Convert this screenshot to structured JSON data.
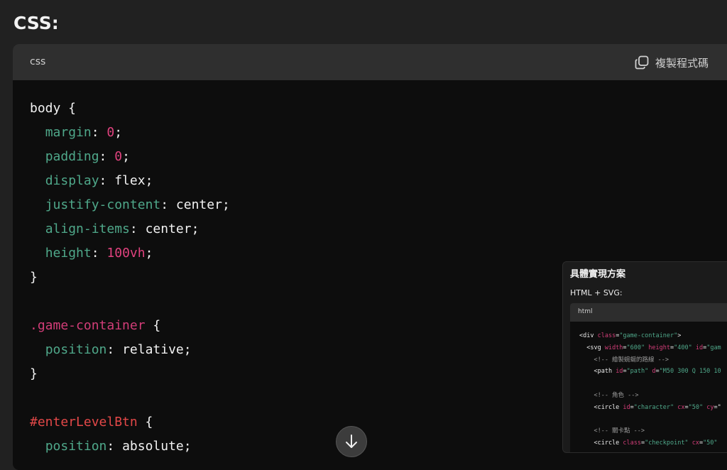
{
  "heading": "CSS:",
  "code_block": {
    "language": "css",
    "copy_label": "複製程式碼",
    "lines": [
      [
        {
          "t": "plain",
          "v": "body {"
        }
      ],
      [
        {
          "t": "plain",
          "v": "  "
        },
        {
          "t": "prop",
          "v": "margin"
        },
        {
          "t": "plain",
          "v": ": "
        },
        {
          "t": "num",
          "v": "0"
        },
        {
          "t": "plain",
          "v": ";"
        }
      ],
      [
        {
          "t": "plain",
          "v": "  "
        },
        {
          "t": "prop",
          "v": "padding"
        },
        {
          "t": "plain",
          "v": ": "
        },
        {
          "t": "num",
          "v": "0"
        },
        {
          "t": "plain",
          "v": ";"
        }
      ],
      [
        {
          "t": "plain",
          "v": "  "
        },
        {
          "t": "prop",
          "v": "display"
        },
        {
          "t": "plain",
          "v": ": flex;"
        }
      ],
      [
        {
          "t": "plain",
          "v": "  "
        },
        {
          "t": "prop",
          "v": "justify-content"
        },
        {
          "t": "plain",
          "v": ": center;"
        }
      ],
      [
        {
          "t": "plain",
          "v": "  "
        },
        {
          "t": "prop",
          "v": "align-items"
        },
        {
          "t": "plain",
          "v": ": center;"
        }
      ],
      [
        {
          "t": "plain",
          "v": "  "
        },
        {
          "t": "prop",
          "v": "height"
        },
        {
          "t": "plain",
          "v": ": "
        },
        {
          "t": "num",
          "v": "100vh"
        },
        {
          "t": "plain",
          "v": ";"
        }
      ],
      [
        {
          "t": "plain",
          "v": "}"
        }
      ],
      [
        {
          "t": "plain",
          "v": ""
        }
      ],
      [
        {
          "t": "cls",
          "v": ".game-container"
        },
        {
          "t": "plain",
          "v": " {"
        }
      ],
      [
        {
          "t": "plain",
          "v": "  "
        },
        {
          "t": "prop",
          "v": "position"
        },
        {
          "t": "plain",
          "v": ": relative;"
        }
      ],
      [
        {
          "t": "plain",
          "v": "}"
        }
      ],
      [
        {
          "t": "plain",
          "v": ""
        }
      ],
      [
        {
          "t": "id",
          "v": "#enterLevelBtn"
        },
        {
          "t": "plain",
          "v": " {"
        }
      ],
      [
        {
          "t": "plain",
          "v": "  "
        },
        {
          "t": "prop",
          "v": "position"
        },
        {
          "t": "plain",
          "v": ": absolute;"
        }
      ]
    ]
  },
  "preview": {
    "title": "具體實現方案",
    "subtitle": "HTML + SVG:",
    "language": "html",
    "lines": [
      [
        {
          "t": "plain",
          "v": "<div "
        },
        {
          "t": "attr",
          "v": "class"
        },
        {
          "t": "plain",
          "v": "="
        },
        {
          "t": "str",
          "v": "\"game-container\""
        },
        {
          "t": "plain",
          "v": ">"
        }
      ],
      [
        {
          "t": "plain",
          "v": "  <svg "
        },
        {
          "t": "attr",
          "v": "width"
        },
        {
          "t": "plain",
          "v": "="
        },
        {
          "t": "str",
          "v": "\"600\""
        },
        {
          "t": "plain",
          "v": " "
        },
        {
          "t": "attr",
          "v": "height"
        },
        {
          "t": "plain",
          "v": "="
        },
        {
          "t": "str",
          "v": "\"400\""
        },
        {
          "t": "plain",
          "v": " "
        },
        {
          "t": "attr",
          "v": "id"
        },
        {
          "t": "plain",
          "v": "="
        },
        {
          "t": "str",
          "v": "\"gam"
        }
      ],
      [
        {
          "t": "cmt",
          "v": "    <!-- 繪製蜿蜒的路線 -->"
        }
      ],
      [
        {
          "t": "plain",
          "v": "    <path "
        },
        {
          "t": "attr",
          "v": "id"
        },
        {
          "t": "plain",
          "v": "="
        },
        {
          "t": "str",
          "v": "\"path\""
        },
        {
          "t": "plain",
          "v": " "
        },
        {
          "t": "attr",
          "v": "d"
        },
        {
          "t": "plain",
          "v": "="
        },
        {
          "t": "str",
          "v": "\"M50 300 Q 150 10"
        }
      ],
      [
        {
          "t": "plain",
          "v": ""
        }
      ],
      [
        {
          "t": "cmt",
          "v": "    <!-- 角色 -->"
        }
      ],
      [
        {
          "t": "plain",
          "v": "    <circle "
        },
        {
          "t": "attr",
          "v": "id"
        },
        {
          "t": "plain",
          "v": "="
        },
        {
          "t": "str",
          "v": "\"character\""
        },
        {
          "t": "plain",
          "v": " "
        },
        {
          "t": "attr",
          "v": "cx"
        },
        {
          "t": "plain",
          "v": "="
        },
        {
          "t": "str",
          "v": "\"50\""
        },
        {
          "t": "plain",
          "v": " "
        },
        {
          "t": "attr",
          "v": "cy"
        },
        {
          "t": "plain",
          "v": "=\""
        }
      ],
      [
        {
          "t": "plain",
          "v": ""
        }
      ],
      [
        {
          "t": "cmt",
          "v": "    <!-- 關卡點 -->"
        }
      ],
      [
        {
          "t": "plain",
          "v": "    <circle "
        },
        {
          "t": "attr",
          "v": "class"
        },
        {
          "t": "plain",
          "v": "="
        },
        {
          "t": "str",
          "v": "\"checkpoint\""
        },
        {
          "t": "plain",
          "v": " "
        },
        {
          "t": "attr",
          "v": "cx"
        },
        {
          "t": "plain",
          "v": "="
        },
        {
          "t": "str",
          "v": "\"50\""
        }
      ]
    ]
  }
}
